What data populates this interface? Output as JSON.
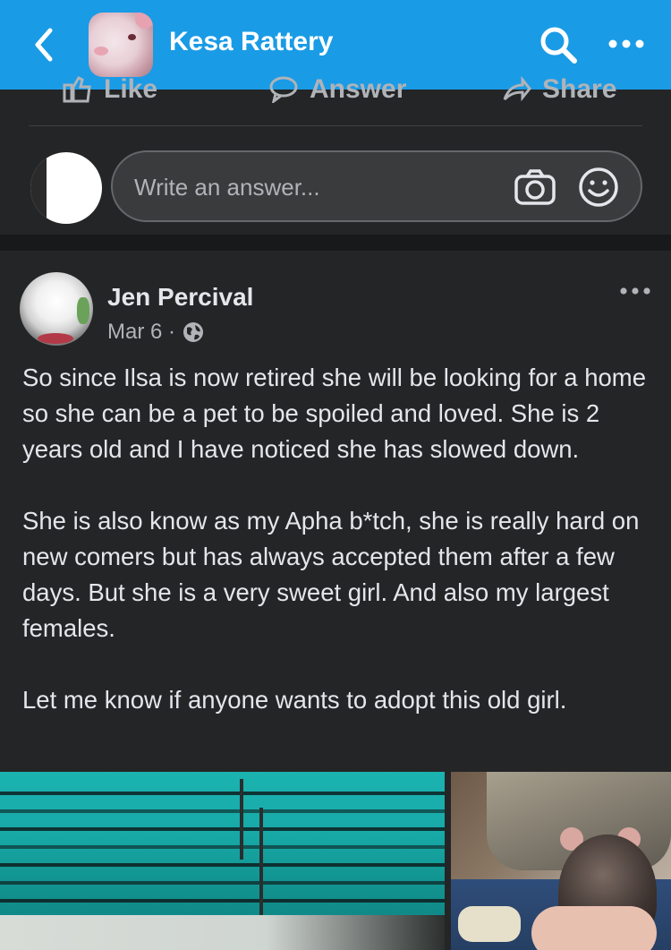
{
  "header": {
    "group_name": "Kesa Rattery",
    "icons": [
      "back-chevron-icon",
      "search-icon",
      "more-dots-icon"
    ]
  },
  "actions": {
    "like": "Like",
    "answer": "Answer",
    "share": "Share"
  },
  "composer": {
    "placeholder": "Write an answer...",
    "icons": [
      "camera-icon",
      "smile-icon"
    ]
  },
  "post": {
    "author": "Jen Percival",
    "date": "Mar 6 ·",
    "audience_icon": "globe-icon",
    "paragraphs": [
      "So since Ilsa is now retired she will be looking for a home so she can be a pet to be spoiled and loved. She is 2 years old and I have noticed she has slowed down.",
      "She is also know as my Apha b*tch, she is really hard on new comers but has always accepted them after a few days. But she is a very sweet girl. And also my largest females.",
      "Let me know if anyone wants to adopt this old girl."
    ]
  },
  "colors": {
    "header_bg": "#1a9be6",
    "page_bg": "#242526",
    "text": "#e4e6eb",
    "muted": "#b0b3b8"
  }
}
